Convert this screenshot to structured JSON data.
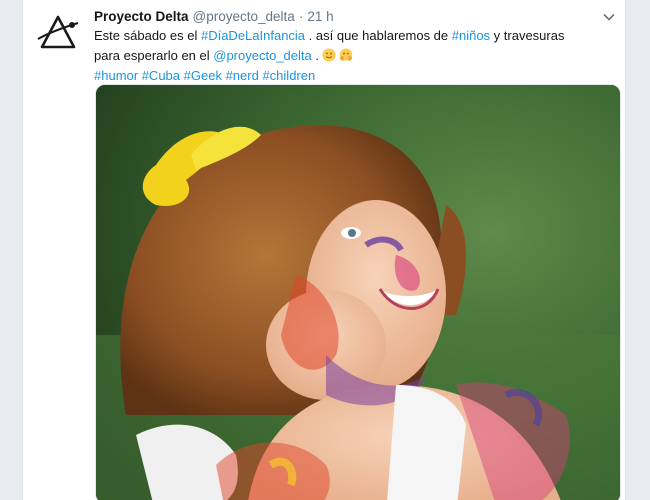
{
  "tweet": {
    "author_name": "Proyecto Delta",
    "author_handle": "@proyecto_delta",
    "separator": "·",
    "time": "21 h",
    "line1_prefix": "Este sábado es el ",
    "hashtag_dia": "#DíaDeLaInfancia",
    "line1_mid": " . así que hablaremos de ",
    "hashtag_ninos": "#niños",
    "line1_suffix": " y travesuras",
    "line2_prefix": "para esperarlo en el ",
    "mention": "@proyecto_delta",
    "line2_suffix": " .",
    "hashtags": [
      "#humor",
      "#Cuba",
      "#Geek",
      "#nerd",
      "#children"
    ]
  },
  "icons": {
    "avatar": "proyecto-delta-logo",
    "menu": "chevron-down-icon",
    "emojis": [
      "smiling-face-emoji",
      "face-with-hands-emoji"
    ]
  },
  "colors": {
    "link": "#1b95e0",
    "text": "#14171a",
    "muted": "#657786",
    "page_bg": "#e6ecf0"
  }
}
